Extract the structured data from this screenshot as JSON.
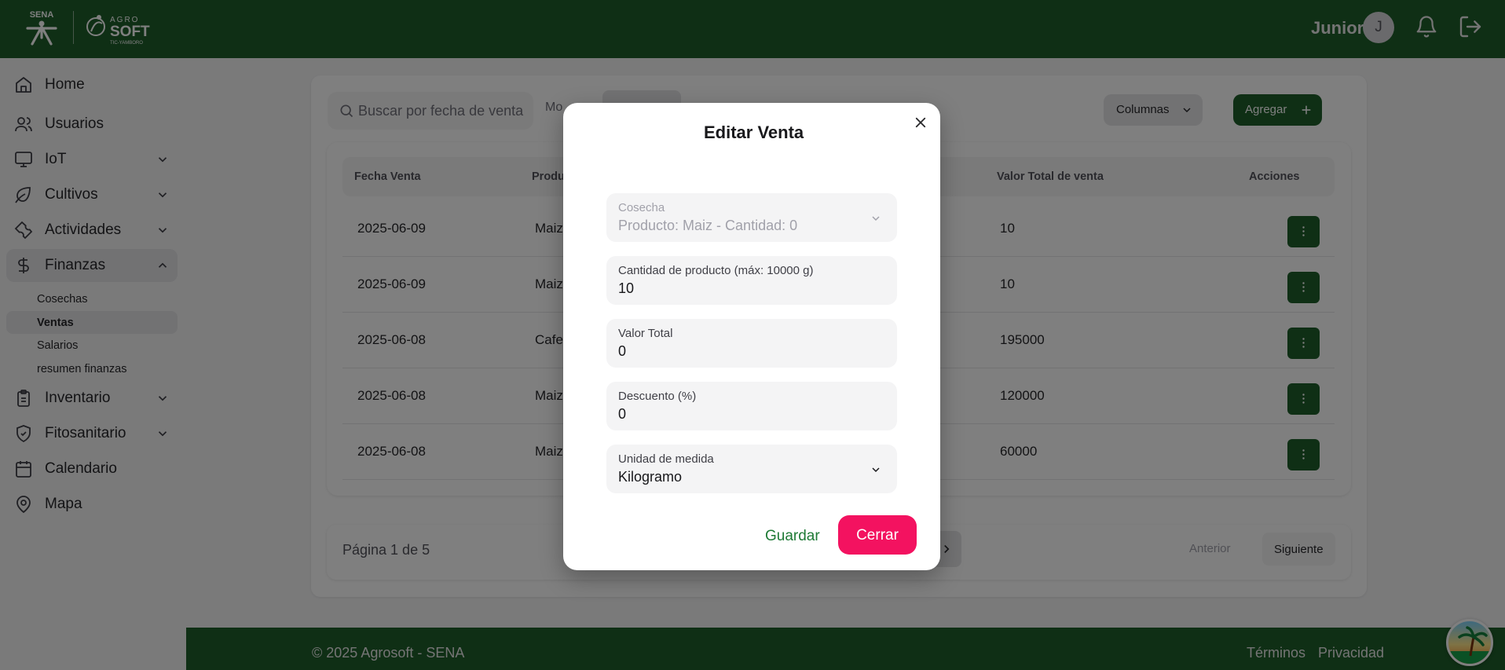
{
  "header": {
    "logo_sena_text": "SENA",
    "logo_agro_text": "AGRO SOFT",
    "logo_agro_sub": "TIC-YAMBORO",
    "user_name": "Junior",
    "avatar_initial": "J"
  },
  "sidebar": {
    "items": [
      {
        "label": "Home",
        "icon": "home-icon"
      },
      {
        "label": "Usuarios",
        "icon": "users-icon"
      },
      {
        "label": "IoT",
        "icon": "monitor-icon"
      },
      {
        "label": "Cultivos",
        "icon": "leaf-icon"
      },
      {
        "label": "Actividades",
        "icon": "wrench-icon"
      },
      {
        "label": "Finanzas",
        "icon": "dollar-icon"
      },
      {
        "label": "Inventario",
        "icon": "clipboard-icon"
      },
      {
        "label": "Fitosanitario",
        "icon": "shield-icon"
      },
      {
        "label": "Calendario",
        "icon": "calendar-icon"
      },
      {
        "label": "Mapa",
        "icon": "map-pin-icon"
      }
    ],
    "finanzas_sub": [
      {
        "label": "Cosechas"
      },
      {
        "label": "Ventas"
      },
      {
        "label": "Salarios"
      },
      {
        "label": "resumen finanzas"
      }
    ]
  },
  "toolbar": {
    "search_placeholder": "Buscar por fecha de venta",
    "mo_label": "Mo",
    "columns_label": "Columnas",
    "add_label": "Agregar"
  },
  "table": {
    "headers": [
      "Fecha Venta",
      "Produ",
      "Valor Total de venta",
      "Acciones"
    ],
    "rows": [
      {
        "fecha": "2025-06-09",
        "producto": "Maiz",
        "valor": "10"
      },
      {
        "fecha": "2025-06-09",
        "producto": "Maiz",
        "valor": "10"
      },
      {
        "fecha": "2025-06-08",
        "producto": "Cafe",
        "valor": "195000"
      },
      {
        "fecha": "2025-06-08",
        "producto": "Maiz",
        "valor": "120000"
      },
      {
        "fecha": "2025-06-08",
        "producto": "Maiz",
        "valor": "60000"
      }
    ]
  },
  "pagination": {
    "text": "Página 1 de 5",
    "prev_label": "Anterior",
    "next_label": "Siguiente"
  },
  "footer": {
    "copyright": "© 2025 Agrosoft - SENA",
    "terms": "Términos",
    "privacy": "Privacidad"
  },
  "modal": {
    "title": "Editar Venta",
    "fields": {
      "cosecha": {
        "label": "Cosecha",
        "value": "Producto: Maiz - Cantidad: 0"
      },
      "cantidad": {
        "label": "Cantidad de producto (máx: 10000 g)",
        "value": "10"
      },
      "valor_total": {
        "label": "Valor Total",
        "value": "0"
      },
      "descuento": {
        "label": "Descuento (%)",
        "value": "0"
      },
      "unidad": {
        "label": "Unidad de medida",
        "value": "Kilogramo"
      }
    },
    "save_label": "Guardar",
    "close_label": "Cerrar"
  },
  "colors": {
    "brand_green": "#1e5e2a",
    "close_button": "#f31260",
    "save_text": "#1e7a35"
  }
}
